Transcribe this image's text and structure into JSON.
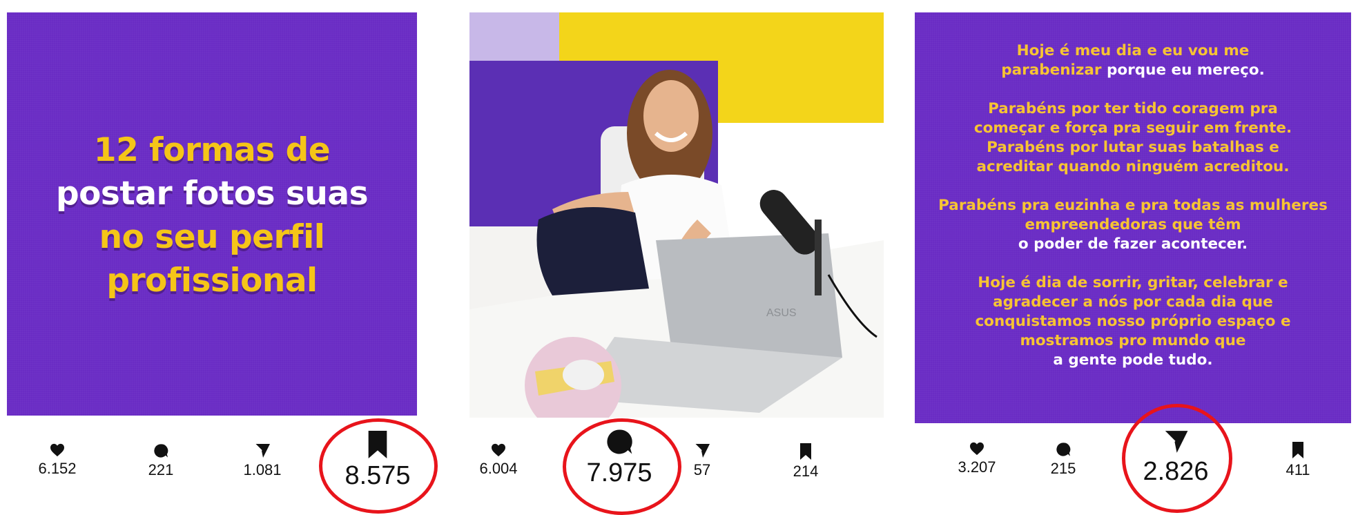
{
  "posts": [
    {
      "title_lines": [
        {
          "text": "12 formas de",
          "color": "yellow"
        },
        {
          "text": "postar fotos suas",
          "color": "white"
        },
        {
          "text": "no seu perfil",
          "color": "yellow"
        },
        {
          "text": "profissional",
          "color": "yellow"
        }
      ],
      "stats": {
        "likes": "6.152",
        "comments": "221",
        "shares": "1.081",
        "saves": "8.575"
      },
      "highlight": "saves"
    },
    {
      "photo_caption": "",
      "stats": {
        "likes": "6.004",
        "comments": "7.975",
        "shares": "57",
        "saves": "214"
      },
      "highlight": "comments"
    },
    {
      "paragraphs": [
        [
          {
            "t": "Hoje é meu dia e eu vou me",
            "c": "y"
          },
          {
            "t": "parabenizar ",
            "c": "y"
          },
          {
            "t": "porque eu mereço.",
            "c": "w"
          }
        ],
        [
          {
            "t": "Parabéns por ter tido coragem pra começar e força pra seguir em frente. Parabéns por lutar suas batalhas e acreditar quando ninguém acreditou.",
            "c": "y"
          }
        ],
        [
          {
            "t": "Parabéns pra euzinha e pra todas as mulheres empreendedoras que têm",
            "c": "y"
          },
          {
            "t": "o poder de fazer acontecer.",
            "c": "w"
          }
        ],
        [
          {
            "t": "Hoje é dia de sorrir, gritar, celebrar e agradecer a nós por cada dia que conquistamos nosso próprio espaço e mostramos pro mundo que",
            "c": "y"
          },
          {
            "t": "a gente pode tudo.",
            "c": "w"
          }
        ]
      ],
      "stats": {
        "likes": "3.207",
        "comments": "215",
        "shares": "2.826",
        "saves": "411"
      },
      "highlight": "shares"
    }
  ],
  "icons": {
    "likes": "heart-icon",
    "comments": "comment-bubble-icon",
    "shares": "send-icon",
    "saves": "bookmark-icon"
  },
  "colors": {
    "purple": "#6a2cc4",
    "yellow": "#f5c518",
    "ring": "#e8141b"
  },
  "laptop_brand": "ASUS"
}
